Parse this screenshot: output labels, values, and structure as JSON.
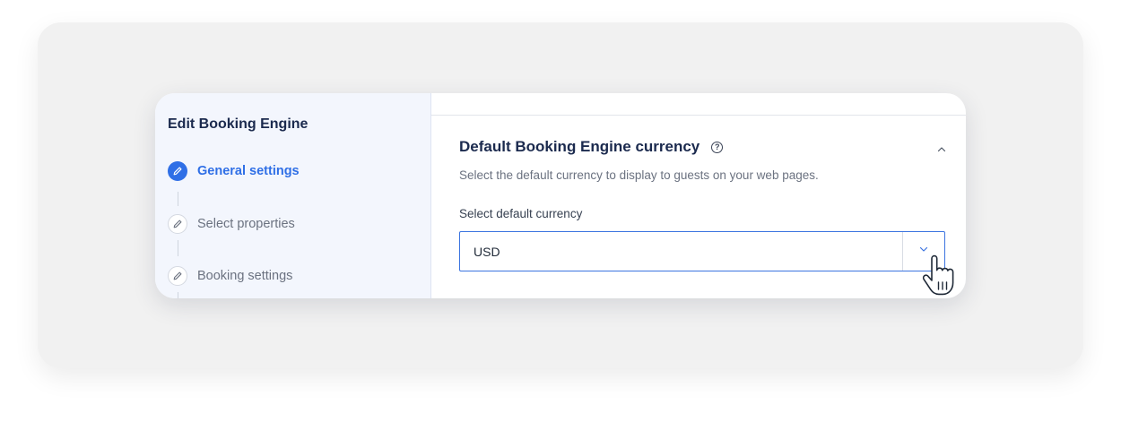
{
  "sidebar": {
    "title": "Edit Booking Engine",
    "steps": [
      {
        "label": "General settings",
        "state": "active",
        "icon": "pencil-icon"
      },
      {
        "label": "Select properties",
        "state": "inactive",
        "icon": "pencil-icon"
      },
      {
        "label": "Booking settings",
        "state": "inactive",
        "icon": "pencil-icon"
      }
    ]
  },
  "section": {
    "title": "Default Booking Engine currency",
    "help_icon": "?",
    "description": "Select the default currency to display to guests on your web pages.",
    "field_label": "Select default currency",
    "selected_currency": "USD",
    "expanded": true
  },
  "colors": {
    "accent": "#2f6fe6",
    "title": "#1b2a4e",
    "sidebar_bg": "#f3f6fd",
    "select_border": "#3b74e0"
  },
  "icons": {
    "collapse": "chevron-up-icon",
    "dropdown": "chevron-down-icon",
    "cursor": "hand-pointer-icon"
  }
}
